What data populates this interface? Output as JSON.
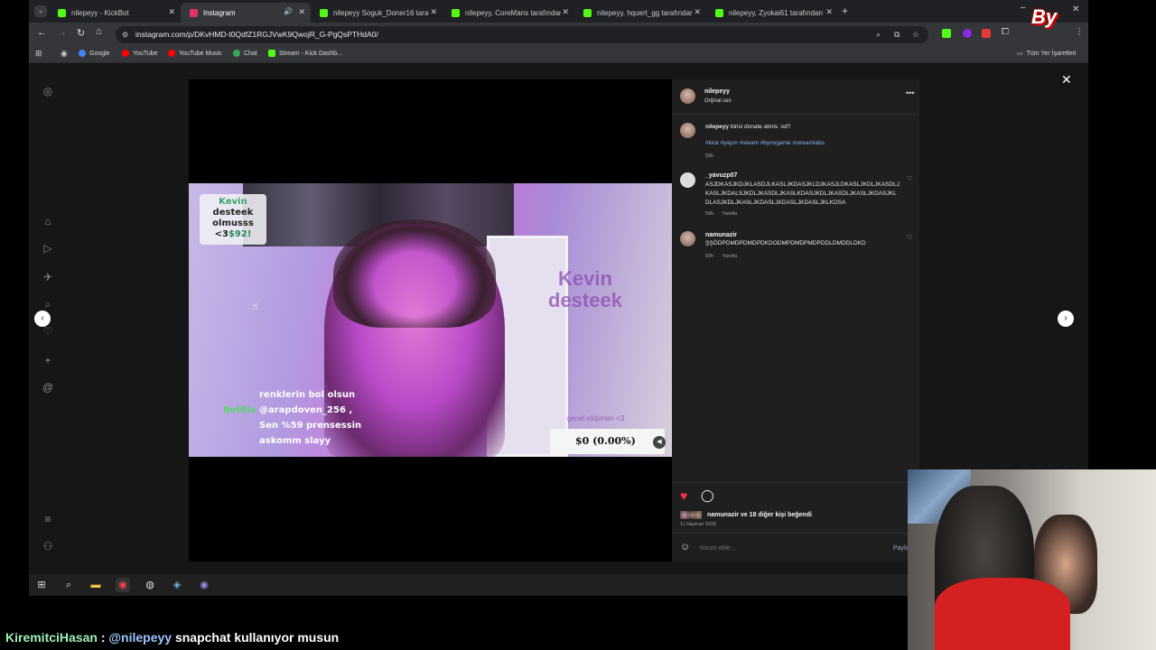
{
  "browser": {
    "tabs": [
      {
        "label": "nilepeyy - KickBot",
        "fav_color": "#53fc18"
      },
      {
        "label": "Instagram",
        "fav_color": "#e1306c"
      },
      {
        "label": "nilepeyy Soguk_Doner16 tarafından",
        "fav_color": "#53fc18"
      },
      {
        "label": "nilepeyy, CoreMans tarafından",
        "fav_color": "#53fc18"
      },
      {
        "label": "nilepeyy, hquert_gg tarafından",
        "fav_color": "#53fc18"
      },
      {
        "label": "nilepeyy, Zyokai61 tarafından",
        "fav_color": "#53fc18"
      }
    ],
    "url": "instagram.com/p/DKvHMD-t0QdfZ1RGJVwK9QwojR_G-PgQsPTHdA0/",
    "bookmarks": [
      {
        "label": "Google",
        "color": "#4285f4"
      },
      {
        "label": "YouTube",
        "color": "#ff0000"
      },
      {
        "label": "YouTube Music",
        "color": "#ff0000"
      },
      {
        "label": "Chat",
        "color": "#34a853"
      },
      {
        "label": "Stream - Kick Dashb...",
        "color": "#53fc18"
      }
    ],
    "all_bookmarks": "Tüm Yer İşaretleri"
  },
  "video": {
    "kevin_box": {
      "l1": "Kevin",
      "l2": "desteek",
      "l3": "olmusss",
      "l4": "<3",
      "l5": "$92!"
    },
    "kevin_big": [
      "Kevin",
      "desteek"
    ],
    "botrix": "BotRix",
    "chat_lines": [
      "renklerin bol olsun",
      "@arapdoven_256 ,",
      "Sen %59 prensessin",
      "askomm slayy"
    ],
    "genel": "genel ekipman <3",
    "goal": "$0 (0.00%)"
  },
  "post": {
    "author": "nilepeyy",
    "audio": "Orijinal ses",
    "caption_user": "nilepeyy",
    "caption": "birisi donate atmis :xd?",
    "tags": "#kick #yayın #steam #bynogame #streamlabs",
    "caption_time": "59h",
    "comments": [
      {
        "user": "_yavuzp07",
        "text": "ASJDKASJKDJKLASDJLKASLJKDASJKLDJKASJLDKASLJKDLJKASDLJKASLJKDALSJKDLJKASDLJKASLKDASJKDLJKASDLJKASLJKDASJKLDLASJKDLJKASLJKDASLJKDASLJKDASLJKLKDSA",
        "time": "59h",
        "reply": "Yanıtla"
      },
      {
        "user": "namunazir",
        "text": "ŞŞÖDPDMDPDMDPDKDODMPDMDPMDPDDLDMDDLDKD",
        "time": "59h",
        "reply": "Yanıtla"
      }
    ],
    "likes": "namunazir ve 18 diğer kişi beğendi",
    "date": "11 Haziran 2025",
    "comment_placeholder": "Yorum ekle...",
    "share": "Paylaş"
  },
  "stream_chat": {
    "user": "KiremitciHasan",
    "sep": " : ",
    "mention": "@nilepeyy",
    "message": " snapchat kullanıyor musun"
  },
  "overlay_logo": "By"
}
